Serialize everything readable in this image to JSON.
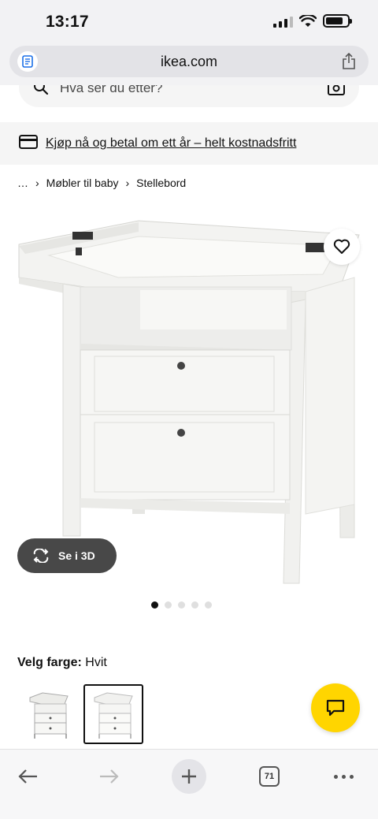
{
  "status": {
    "time": "13:17",
    "battery_level": 0.8
  },
  "browser": {
    "url": "ikea.com",
    "tabs_count": "71"
  },
  "search": {
    "placeholder": "Hva ser du etter?"
  },
  "promo": {
    "text": "Kjøp nå og betal om ett år – helt kostnadsfritt"
  },
  "breadcrumb": {
    "items": [
      "…",
      "Møbler til baby",
      "Stellebord"
    ]
  },
  "product": {
    "view3d_label": "Se i 3D",
    "carousel": {
      "count": 5,
      "active": 0
    }
  },
  "color": {
    "label": "Velg farge:",
    "value": "Hvit"
  },
  "icons": {
    "reader": "reader-icon",
    "share": "share-icon",
    "search": "search-icon",
    "camera": "camera-icon",
    "card": "credit-card-icon",
    "favorite": "heart-icon",
    "rotate": "rotate-3d-icon",
    "chat": "chat-icon",
    "back": "back-arrow-icon",
    "forward": "forward-arrow-icon",
    "new_tab": "plus-icon",
    "more": "more-icon"
  },
  "colors": {
    "chat_button": "#ffd500",
    "view3d_bg": "#484848",
    "promo_bg": "#f5f5f5"
  }
}
